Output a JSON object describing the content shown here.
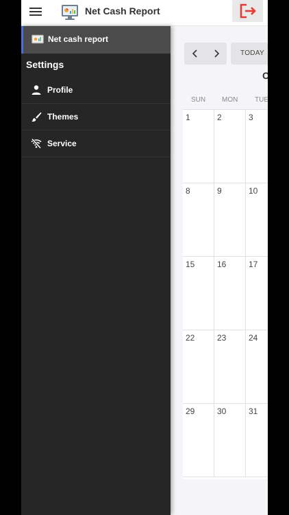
{
  "app": {
    "title": "Net Cash Report"
  },
  "drawer": {
    "active_item": "Net cash report",
    "section_title": "Settings",
    "items": [
      {
        "label": "Profile",
        "icon": "person-icon"
      },
      {
        "label": "Themes",
        "icon": "brush-icon"
      },
      {
        "label": "Service",
        "icon": "wifi-off-icon"
      }
    ]
  },
  "calendar": {
    "today_label": "TODAY",
    "month_title_partial": "C",
    "weekdays": [
      "SUN",
      "MON",
      "TUE"
    ],
    "rows": [
      [
        "1",
        "2",
        "3"
      ],
      [
        "8",
        "9",
        "10"
      ],
      [
        "15",
        "16",
        "17"
      ],
      [
        "22",
        "23",
        "24"
      ],
      [
        "29",
        "30",
        "31"
      ]
    ]
  },
  "colors": {
    "drawer_bg": "#262626",
    "active_accent": "#4a6dd6",
    "logout_red": "#e53935"
  }
}
